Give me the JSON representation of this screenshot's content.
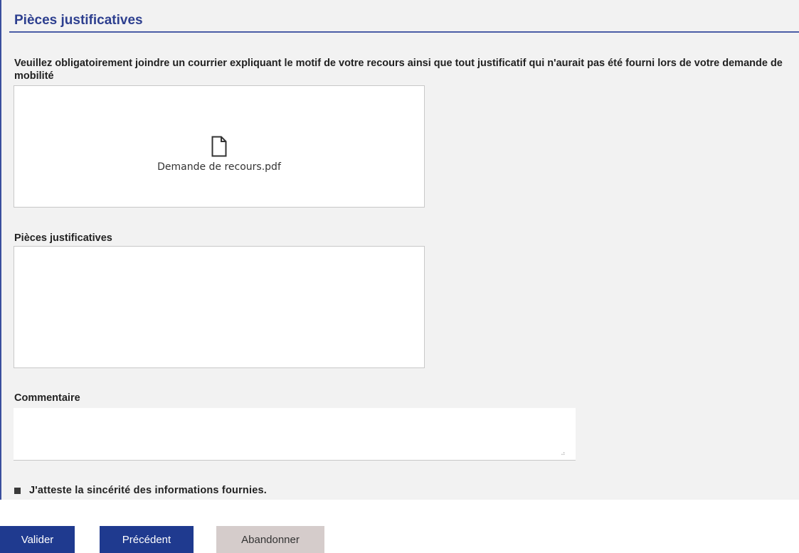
{
  "section": {
    "title": "Pièces justificatives",
    "instructions": "Veuillez obligatoirement joindre un courrier expliquant le motif de votre recours ainsi que tout justificatif qui n'aurait pas été fourni lors de votre demande de mobilité"
  },
  "upload1": {
    "files": [
      {
        "name": "Demande de recours.pdf",
        "icon": "file-icon"
      }
    ]
  },
  "pieces": {
    "label": "Pièces justificatives"
  },
  "comment": {
    "label": "Commentaire",
    "value": ""
  },
  "attestation": {
    "label": "J'atteste la sincérité des informations fournies.",
    "checked": true
  },
  "buttons": {
    "valider": "Valider",
    "precedent": "Précédent",
    "abandonner": "Abandonner"
  },
  "colors": {
    "accent": "#1f3a8f",
    "title": "#2d3f8f",
    "panel": "#f2f2f2",
    "secondary_button": "#d5cccb"
  }
}
